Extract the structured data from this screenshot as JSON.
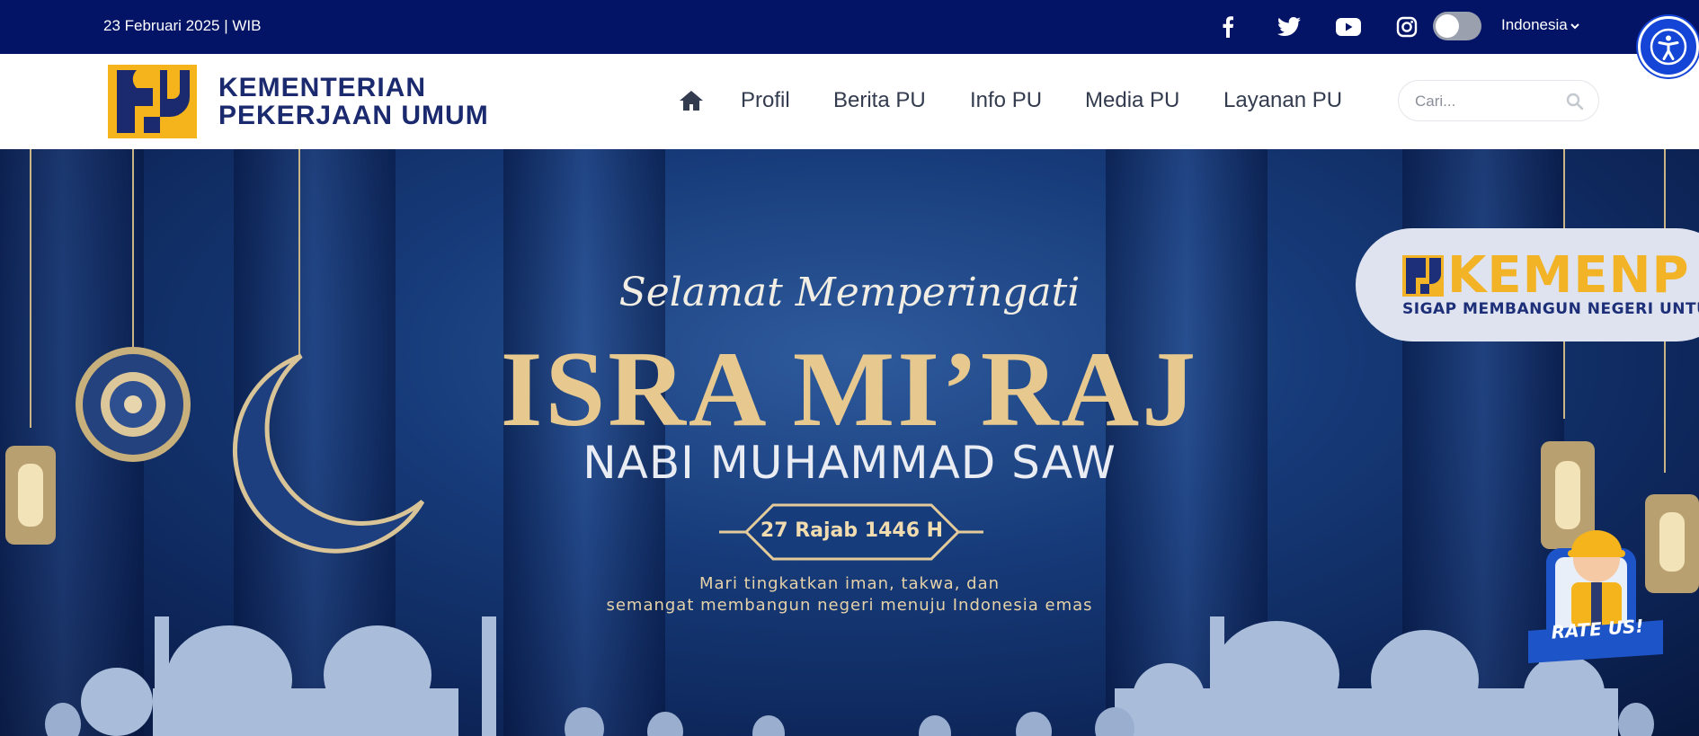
{
  "topbar": {
    "date": "23 Februari 2025 | WIB",
    "social_icons": [
      "facebook-icon",
      "twitter-icon",
      "youtube-icon",
      "instagram-icon"
    ],
    "dark_mode_toggle": false,
    "language": "Indonesia"
  },
  "header": {
    "brand_line1": "KEMENTERIAN",
    "brand_line2": "PEKERJAAN UMUM",
    "nav": {
      "home_icon": "home-icon",
      "items": [
        "Profil",
        "Berita PU",
        "Info PU",
        "Media PU",
        "Layanan PU"
      ]
    },
    "search": {
      "placeholder": "Cari...",
      "icon": "search-icon"
    }
  },
  "banner": {
    "greeting": "Selamat Memperingati",
    "title": "ISRA MI’RAJ",
    "subtitle": "NABI MUHAMMAD SAW",
    "date_label": "27 Rajab 1446  H",
    "message_line1": "Mari tingkatkan iman, takwa, dan",
    "message_line2": "semangat membangun negeri menuju Indonesia emas",
    "badge_text": "KEMENP",
    "badge_tagline": "SIGAP MEMBANGUN NEGERI UNTUK R",
    "rate_label": "RATE US!"
  },
  "colors": {
    "topbar_bg": "#031467",
    "brand_navy": "#1b2a6e",
    "brand_yellow": "#f5b31c",
    "accessibility_blue": "#1545d6",
    "banner_gold": "#e7c98f"
  }
}
